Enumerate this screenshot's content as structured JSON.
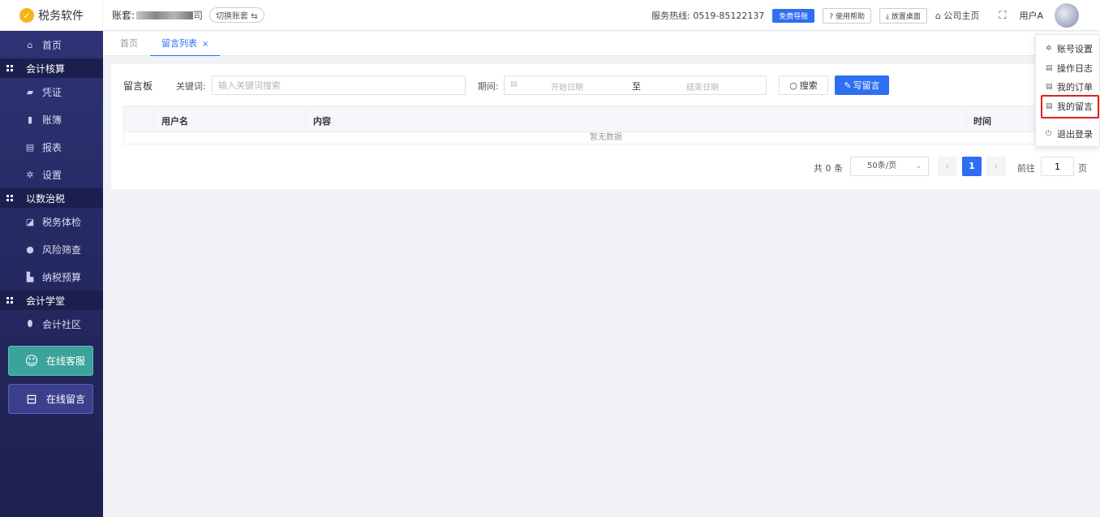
{
  "app": {
    "logo_text": "税务软件",
    "logo_glyph": "✓"
  },
  "sidebar": {
    "home": {
      "label": "首页",
      "icon": "home-icon"
    },
    "groups": [
      {
        "title": "会计核算",
        "items": [
          {
            "label": "凭证",
            "icon": "voucher-icon"
          },
          {
            "label": "账簿",
            "icon": "ledger-icon"
          },
          {
            "label": "报表",
            "icon": "report-icon"
          },
          {
            "label": "设置",
            "icon": "gear-icon"
          }
        ]
      },
      {
        "title": "以数治税",
        "items": [
          {
            "label": "税务体检",
            "icon": "chart-icon"
          },
          {
            "label": "风险筛查",
            "icon": "risk-icon"
          },
          {
            "label": "纳税预算",
            "icon": "document-icon"
          }
        ]
      },
      {
        "title": "会计学堂",
        "items": [
          {
            "label": "会计社区",
            "icon": "location-icon"
          }
        ]
      }
    ],
    "online_service": "在线客服",
    "online_message": "在线留言"
  },
  "topbar": {
    "account_label": "账套:",
    "account_name_tail": "司",
    "switch_account": "切换账套",
    "hotline": "服务热线:  0519-85122137",
    "free_guide": "免费导账",
    "help": "使用帮助",
    "desktop": "放置桌面",
    "company_home": "公司主页",
    "user": "用户A"
  },
  "tabs": {
    "home": "首页",
    "active": "留言列表",
    "close": "×"
  },
  "board": {
    "title": "留言板",
    "keyword_label": "关键词:",
    "keyword_placeholder": "输入关键词搜索",
    "period_label": "期间:",
    "start_placeholder": "开始日期",
    "separator": "至",
    "end_placeholder": "结束日期",
    "search_button": "搜索",
    "write_button": "写留言"
  },
  "table": {
    "columns": [
      "用户名",
      "内容",
      "时间"
    ],
    "rows": [],
    "empty_text": "暂无数据"
  },
  "pagination": {
    "total": "共 0 条",
    "page_size": "50条/页",
    "current_page": "1",
    "goto_label": "前往",
    "goto_value": "1",
    "page_unit": "页"
  },
  "user_menu": {
    "items": [
      "账号设置",
      "操作日志",
      "我的订单",
      "我的留言",
      "退出登录"
    ],
    "highlighted": "我的留言"
  },
  "colors": {
    "accent": "#2f6ef2",
    "sidebar": "#2f3478",
    "service": "#3ca39a",
    "highlight": "#e02020"
  }
}
